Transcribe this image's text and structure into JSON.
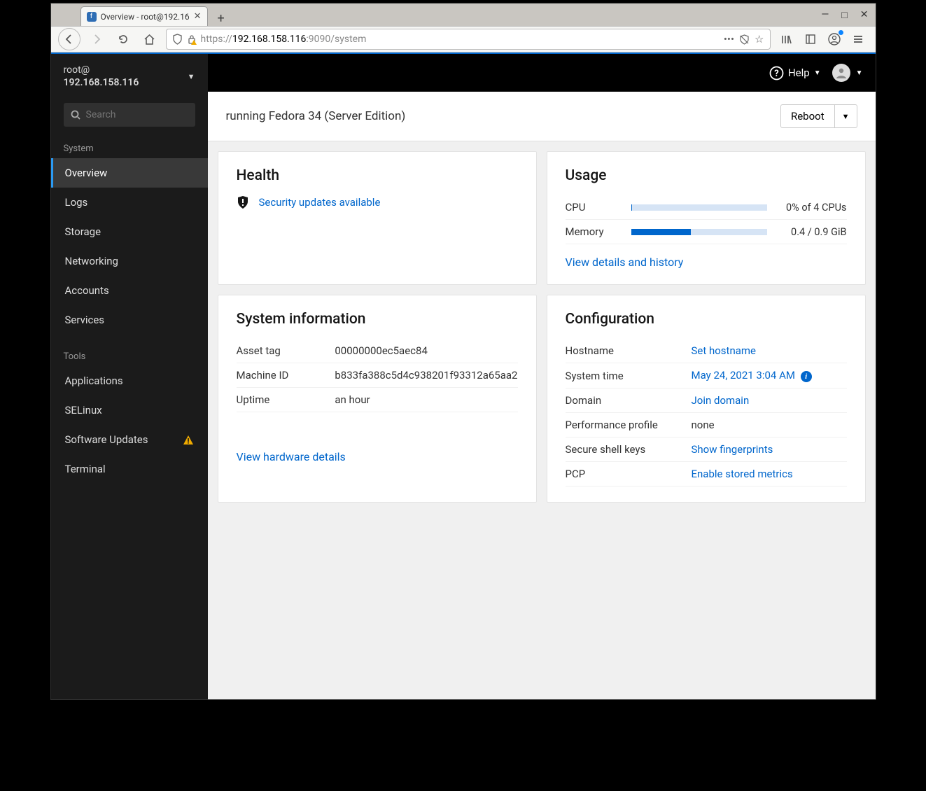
{
  "browser": {
    "tab_title": "Overview - root@192.16",
    "url_prefix": "https://",
    "url_host": "192.168.158.116",
    "url_path": ":9090/system"
  },
  "sidebar": {
    "user_prefix": "root@",
    "host": "192.168.158.116",
    "search_placeholder": "Search",
    "section_system": "System",
    "section_tools": "Tools",
    "items_system": [
      {
        "label": "Overview"
      },
      {
        "label": "Logs"
      },
      {
        "label": "Storage"
      },
      {
        "label": "Networking"
      },
      {
        "label": "Accounts"
      },
      {
        "label": "Services"
      }
    ],
    "items_tools": [
      {
        "label": "Applications"
      },
      {
        "label": "SELinux"
      },
      {
        "label": "Software Updates"
      },
      {
        "label": "Terminal"
      }
    ]
  },
  "topbar": {
    "help": "Help"
  },
  "page": {
    "subtitle": "running Fedora 34 (Server Edition)",
    "reboot": "Reboot"
  },
  "health": {
    "title": "Health",
    "updates_link": "Security updates available"
  },
  "usage": {
    "title": "Usage",
    "cpu_label": "CPU",
    "cpu_value": "0% of 4 CPUs",
    "cpu_pct": 1,
    "mem_label": "Memory",
    "mem_value": "0.4 / 0.9 GiB",
    "mem_pct": 44,
    "details_link": "View details and history"
  },
  "sysinfo": {
    "title": "System information",
    "rows": [
      {
        "k": "Asset tag",
        "v": "00000000ec5aec84"
      },
      {
        "k": "Machine ID",
        "v": "b833fa388c5d4c938201f93312a65aa2"
      },
      {
        "k": "Uptime",
        "v": "an hour"
      }
    ],
    "hw_link": "View hardware details"
  },
  "config": {
    "title": "Configuration",
    "rows": [
      {
        "k": "Hostname",
        "link": "Set hostname"
      },
      {
        "k": "System time",
        "link": "May 24, 2021 3:04 AM",
        "info": true
      },
      {
        "k": "Domain",
        "link": "Join domain"
      },
      {
        "k": "Performance profile",
        "v": "none"
      },
      {
        "k": "Secure shell keys",
        "link": "Show fingerprints"
      },
      {
        "k": "PCP",
        "link": "Enable stored metrics"
      }
    ]
  }
}
